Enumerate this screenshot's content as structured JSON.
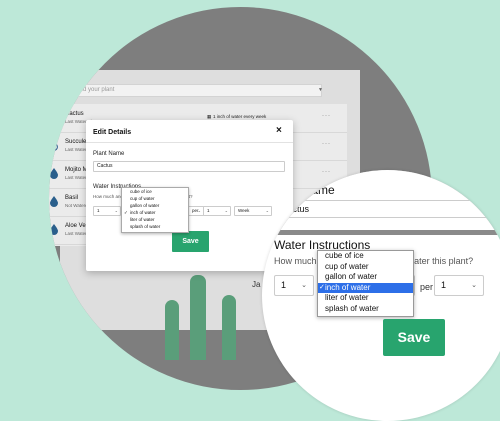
{
  "app": {
    "add_placeholder": "Type to add your plant",
    "plants": [
      {
        "name": "Cactus",
        "last": "Last Watered"
      },
      {
        "name": "Succulent",
        "last": "Last Watered"
      },
      {
        "name": "Mojito Mint",
        "last": "Last Watered"
      },
      {
        "name": "Basil",
        "last": "Not Watered"
      },
      {
        "name": "Aloe Vera",
        "last": "Last Watered"
      }
    ],
    "cactus_note": "1 inch of water every week",
    "cactus_note_icon": "calendar-icon",
    "row_menu": "···",
    "behind_modal_label": "Ja"
  },
  "modal": {
    "title": "Edit Details",
    "close": "×",
    "plant_name_label": "Plant Name",
    "plant_name_value": "Cactus",
    "water_label": "Water Instructions",
    "water_question": "How much and how often do you water this plant?",
    "amount": "1",
    "unit": "inch of water",
    "per_label": "per",
    "frequency": "1",
    "period": "Week",
    "save_label": "Save",
    "unit_options": [
      "cube of ice",
      "cup of water",
      "gallon of water",
      "inch of water",
      "liter of water",
      "splash of water"
    ],
    "selected_unit_index": 3,
    "checkmark": "✓"
  },
  "colors": {
    "background": "#bde8d8",
    "save_green": "#28a46e",
    "selected_blue": "#2d6fe8",
    "drop_blue": "#2a5f8c"
  }
}
